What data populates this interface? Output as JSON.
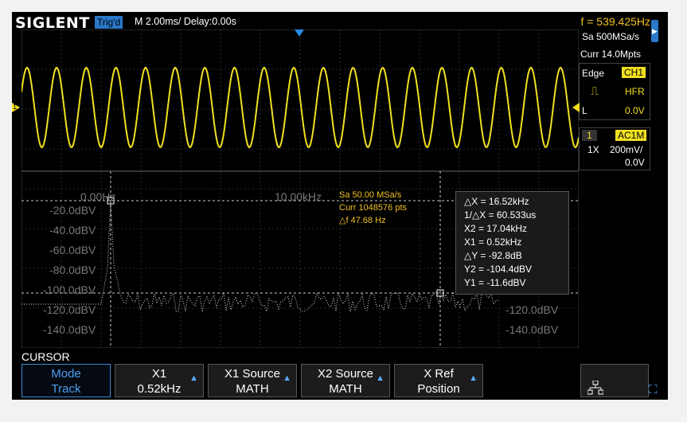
{
  "header": {
    "brand": "SIGLENT",
    "trigger_state": "Trig'd",
    "timebase": "M 2.00ms/ Delay:0.00s",
    "frequency": "f = 539.425Hz"
  },
  "right_panel": {
    "sample_rate": "Sa 500MSa/s",
    "memory_depth": "Curr 14.0Mpts",
    "trigger_type": "Edge",
    "trigger_source": "CH1",
    "coupling_mode": "HFR",
    "trigger_mode_letter": "L",
    "trigger_level": "0.0V",
    "channel_number": "1",
    "channel_coupling": "AC1M",
    "probe": "1X",
    "volts_per_div": "200mV/",
    "offset": "0.0V"
  },
  "waveform": {
    "channel_marker": "1",
    "color": "#f0e020"
  },
  "fft": {
    "x_labels": [
      "0.00Hz",
      "10.00kHz"
    ],
    "y_labels_left": [
      "-20.0dBV",
      "-40.0dBV",
      "-60.0dBV",
      "-80.0dBV",
      "-100.0dBV",
      "-120.0dBV",
      "-140.0dBV"
    ],
    "y_labels_right": [
      "-120.0dBV",
      "-140.0dBV"
    ],
    "math_sample_rate": "Sa 50.00 MSa/s",
    "math_points": "Curr 1048576 pts",
    "math_delta_f": "△f 47.68 Hz"
  },
  "cursor_readout": {
    "dx": "△X = 16.52kHz",
    "inv_dx": "1/△X = 60.533us",
    "x2": "X2 = 17.04kHz",
    "x1": "X1 = 0.52kHz",
    "dy": "△Y = -92.8dB",
    "y2": "Y2 = -104.4dBV",
    "y1": "Y1 = -11.6dBV"
  },
  "softkeys": {
    "menu_title": "CURSOR",
    "mode_label": "Mode",
    "mode_value": "Track",
    "x1_label": "X1",
    "x1_value": "0.52kHz",
    "x1_source_label": "X1 Source",
    "x1_source_value": "MATH",
    "x2_source_label": "X2 Source",
    "x2_source_value": "MATH",
    "xref_label": "X Ref",
    "xref_value": "Position"
  },
  "colors": {
    "accent_blue": "#2a78c9",
    "trace_yellow": "#f0e020",
    "math_orange": "#f0c020"
  }
}
